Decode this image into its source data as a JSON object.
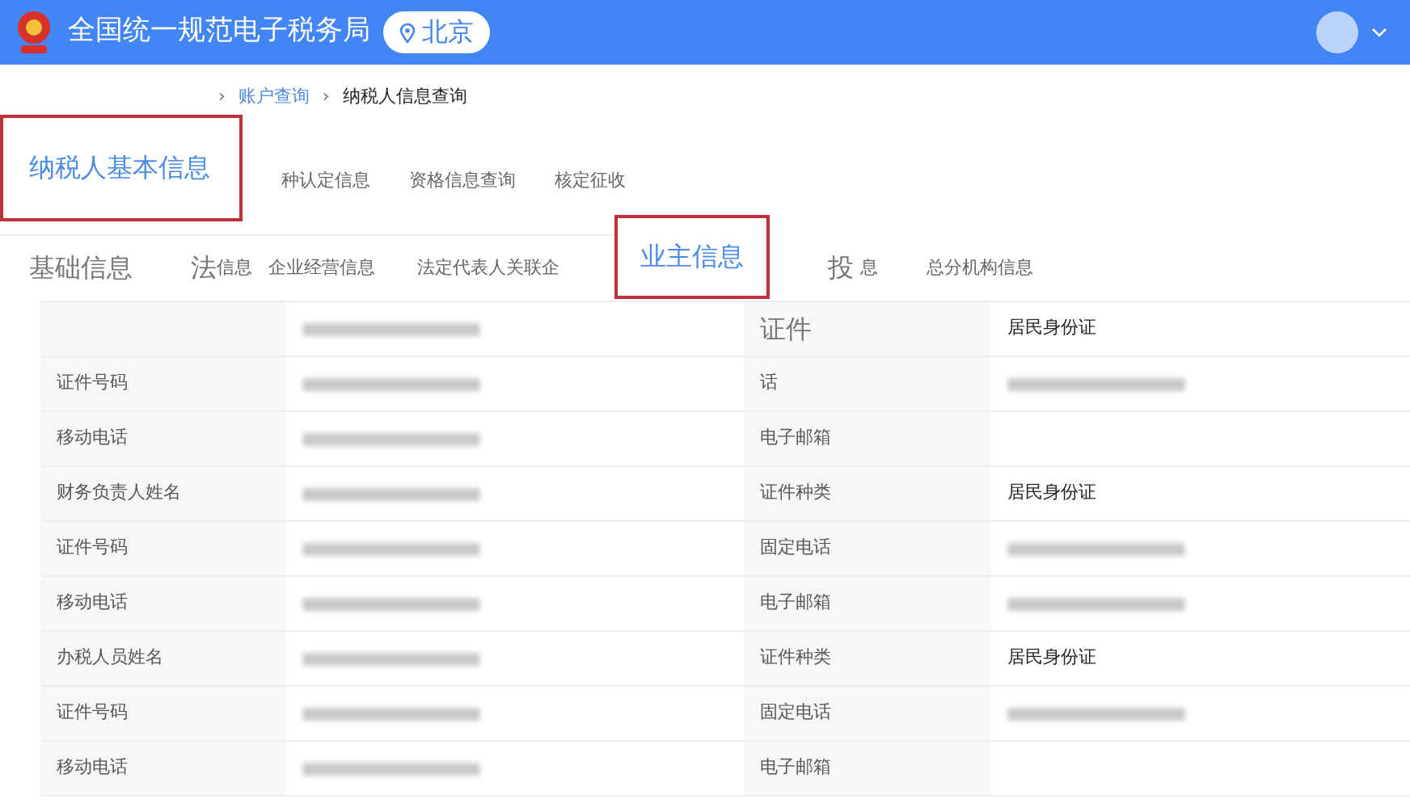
{
  "header": {
    "title": "全国统一规范电子税务局",
    "location": "北京"
  },
  "breadcrumb": [
    {
      "label": "›"
    },
    {
      "label": "账户查询",
      "link": true
    },
    {
      "label": "›"
    },
    {
      "label": "纳税人信息查询",
      "link": false
    }
  ],
  "tabs_primary": [
    {
      "label": "纳税人基本信息",
      "selected": true,
      "callout": true
    },
    {
      "label": "种认定信息",
      "selected": false,
      "callout": false
    },
    {
      "label": "资格信息查询",
      "selected": false,
      "callout": false
    },
    {
      "label": "核定征收",
      "selected": false,
      "callout": false
    }
  ],
  "tabs_secondary": [
    {
      "label": "基础信息",
      "selected": false,
      "kind": "large"
    },
    {
      "label": "法",
      "selected": false,
      "kind": "large"
    },
    {
      "label": "信息",
      "selected": false,
      "kind": "normal"
    },
    {
      "label": "企业经营信息",
      "selected": false,
      "kind": "normal"
    },
    {
      "label": "法定代表人关联企",
      "selected": false,
      "kind": "normal"
    },
    {
      "label": "业主信息",
      "selected": true,
      "kind": "callout"
    },
    {
      "label": "投",
      "selected": false,
      "kind": "large"
    },
    {
      "label": "息",
      "selected": false,
      "kind": "normal"
    },
    {
      "label": "总分机构信息",
      "selected": false,
      "kind": "normal"
    }
  ],
  "table": {
    "rows": [
      [
        {
          "kind": "empty"
        },
        {
          "kind": "redacted"
        },
        {
          "kind": "label_large",
          "text": "证件"
        },
        {
          "kind": "text",
          "text": "居民身份证"
        }
      ],
      [
        {
          "kind": "label",
          "text": "证件号码"
        },
        {
          "kind": "redacted"
        },
        {
          "kind": "label",
          "text": "话"
        },
        {
          "kind": "redacted"
        }
      ],
      [
        {
          "kind": "label",
          "text": "移动电话"
        },
        {
          "kind": "redacted"
        },
        {
          "kind": "label",
          "text": "电子邮箱"
        },
        {
          "kind": "empty"
        }
      ],
      [
        {
          "kind": "label",
          "text": "财务负责人姓名"
        },
        {
          "kind": "redacted"
        },
        {
          "kind": "label",
          "text": "证件种类"
        },
        {
          "kind": "text",
          "text": "居民身份证"
        }
      ],
      [
        {
          "kind": "label",
          "text": "证件号码"
        },
        {
          "kind": "redacted"
        },
        {
          "kind": "label",
          "text": "固定电话"
        },
        {
          "kind": "redacted"
        }
      ],
      [
        {
          "kind": "label",
          "text": "移动电话"
        },
        {
          "kind": "redacted"
        },
        {
          "kind": "label",
          "text": "电子邮箱"
        },
        {
          "kind": "redacted"
        }
      ],
      [
        {
          "kind": "label",
          "text": "办税人员姓名"
        },
        {
          "kind": "redacted"
        },
        {
          "kind": "label",
          "text": "证件种类"
        },
        {
          "kind": "text",
          "text": "居民身份证"
        }
      ],
      [
        {
          "kind": "label",
          "text": "证件号码"
        },
        {
          "kind": "redacted"
        },
        {
          "kind": "label",
          "text": "固定电话"
        },
        {
          "kind": "redacted"
        }
      ],
      [
        {
          "kind": "label",
          "text": "移动电话"
        },
        {
          "kind": "redacted"
        },
        {
          "kind": "label",
          "text": "电子邮箱"
        },
        {
          "kind": "empty"
        }
      ]
    ]
  }
}
